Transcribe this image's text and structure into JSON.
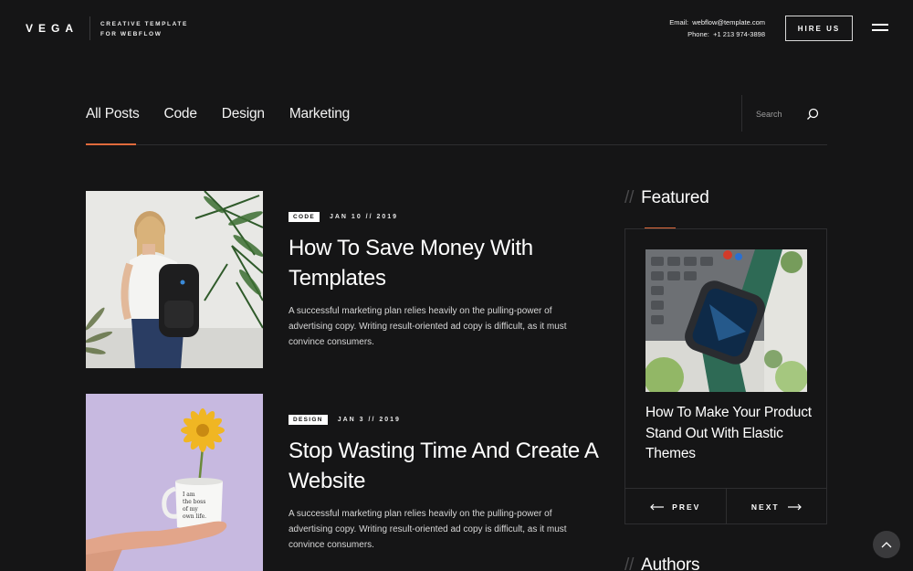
{
  "header": {
    "logo": "VEGA",
    "tagline_line1": "CREATIVE TEMPLATE",
    "tagline_line2": "FOR WEBFLOW",
    "email_label": "Email:",
    "email": "webflow@template.com",
    "phone_label": "Phone:",
    "phone": "+1 213 974-3898",
    "hire_label": "HIRE US",
    "menu_icon": "hamburger-icon"
  },
  "tabs": [
    {
      "label": "All Posts",
      "active": true
    },
    {
      "label": "Code",
      "active": false
    },
    {
      "label": "Design",
      "active": false
    },
    {
      "label": "Marketing",
      "active": false
    }
  ],
  "search": {
    "placeholder": "Search",
    "icon": "search-icon"
  },
  "posts": [
    {
      "category": "CODE",
      "date": "JAN 10 // 2019",
      "title": "How To Save Money With Templates",
      "excerpt": "A successful marketing plan relies heavily on the pulling-power of advertising copy. Writing result-oriented ad copy is difficult, as it must convince consumers."
    },
    {
      "category": "DESIGN",
      "date": "JAN 3 // 2019",
      "title": "Stop Wasting Time And Create A Website",
      "excerpt": "A successful marketing plan relies heavily on the pulling-power of advertising copy. Writing result-oriented ad copy is difficult, as it must convince consumers.",
      "mug_text": "I am the boss of my own life."
    }
  ],
  "sidebar": {
    "slashes": "//",
    "featured_heading": "Featured",
    "featured_title": "How To Make Your Product Stand Out With Elastic Themes",
    "prev_label": "PREV",
    "next_label": "NEXT",
    "authors_heading": "Authors"
  },
  "colors": {
    "accent": "#e06a3c",
    "background": "#151516",
    "border": "#2e2e30"
  },
  "scroll_top_icon": "chevron-up-icon"
}
